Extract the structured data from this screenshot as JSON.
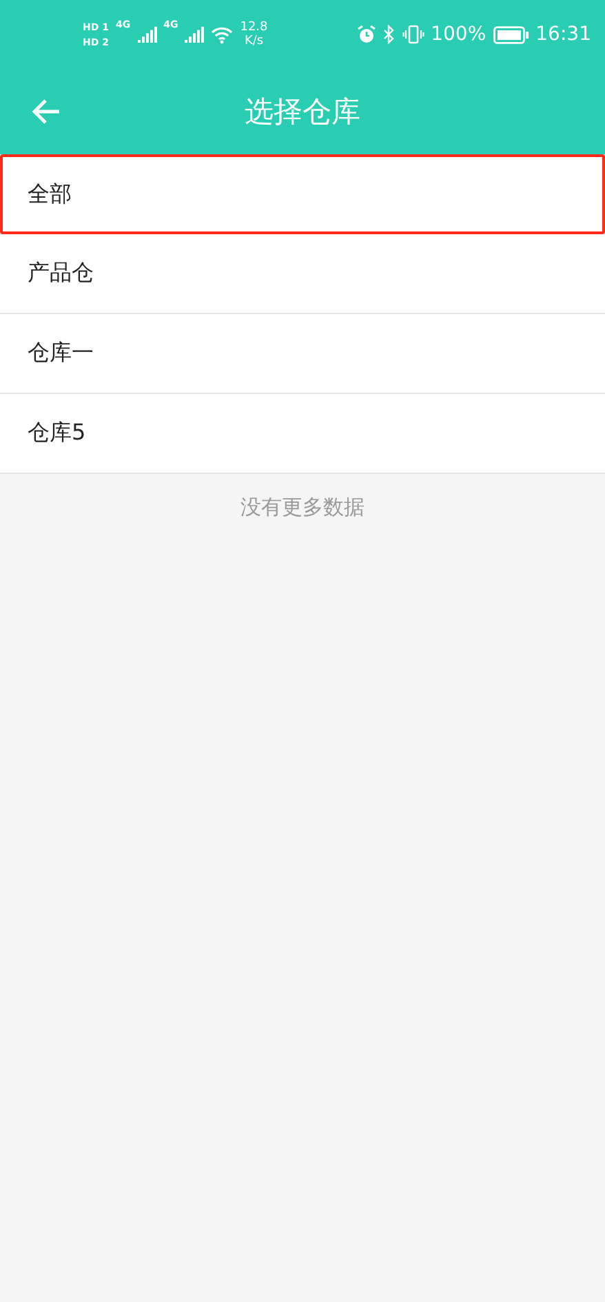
{
  "status_bar": {
    "sim": [
      {
        "badge": "HD",
        "slot": "1"
      },
      {
        "badge": "HD",
        "slot": "2"
      }
    ],
    "network": [
      "4G",
      "4G"
    ],
    "speed": {
      "value": "12.8",
      "unit": "K/s"
    },
    "battery": "100%",
    "time": "16:31"
  },
  "header": {
    "title": "选择仓库"
  },
  "items": [
    {
      "label": "全部",
      "selected": true
    },
    {
      "label": "产品仓",
      "selected": false
    },
    {
      "label": "仓库一",
      "selected": false
    },
    {
      "label": "仓库5",
      "selected": false
    }
  ],
  "footer": "没有更多数据"
}
